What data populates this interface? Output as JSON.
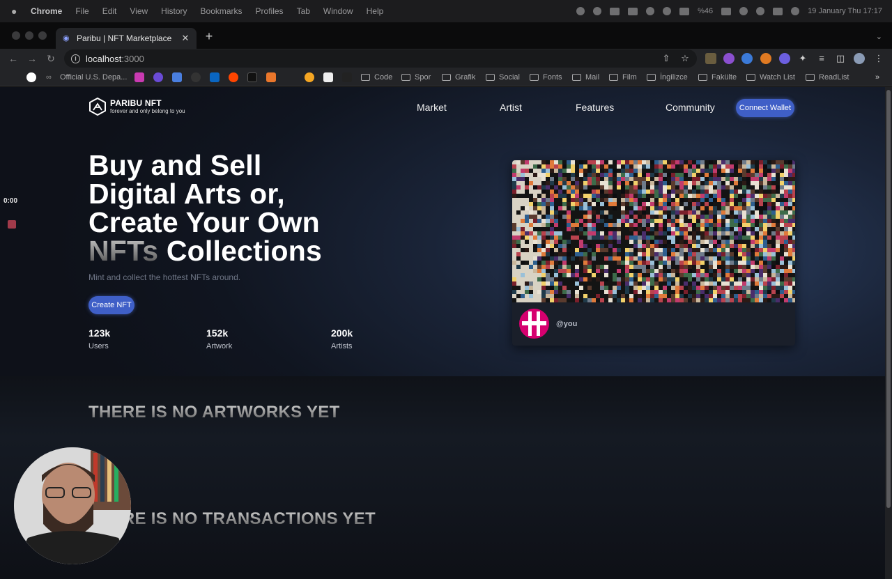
{
  "menubar": {
    "app": "Chrome",
    "items": [
      "File",
      "Edit",
      "View",
      "History",
      "Bookmarks",
      "Profiles",
      "Tab",
      "Window",
      "Help"
    ],
    "battery": "%46",
    "datetime": "19 January Thu  17:17"
  },
  "tab": {
    "title": "Paribu | NFT Marketplace"
  },
  "address": {
    "host": "localhost",
    "port": ":3000"
  },
  "bookmarks": {
    "first": "Official U.S. Depa...",
    "folders": [
      "Code",
      "Spor",
      "Grafik",
      "Social",
      "Fonts",
      "Mail",
      "Film",
      "İngilizce",
      "Fakülte",
      "Watch List",
      "ReadList"
    ],
    "overflow": "»"
  },
  "site": {
    "brand": "PARIBU NFT",
    "tagline": "forever and only belong to you",
    "nav": [
      "Market",
      "Artist",
      "Features",
      "Community"
    ],
    "connect": "Connect Wallet",
    "hero": {
      "line1": "Buy and Sell",
      "line2": "Digital Arts or,",
      "line3": "Create Your Own",
      "line4a": "NFTs",
      "line4b": " Collections"
    },
    "subtitle": "Mint and collect the hottest NFTs around.",
    "create_button": "Create NFT",
    "stats": [
      {
        "value": "123k",
        "label": "Users"
      },
      {
        "value": "152k",
        "label": "Artwork"
      },
      {
        "value": "200k",
        "label": "Artists"
      }
    ],
    "card_handle": "@you",
    "empty_artworks": "THERE IS NO ARTWORKS YET",
    "empty_transactions": "THERE IS NO TRANSACTIONS YET"
  },
  "recording": {
    "timer": "0:00"
  },
  "colors": {
    "accent": "#3f5fc7",
    "avatar": "#d6006f",
    "page_bg": "#101520"
  }
}
